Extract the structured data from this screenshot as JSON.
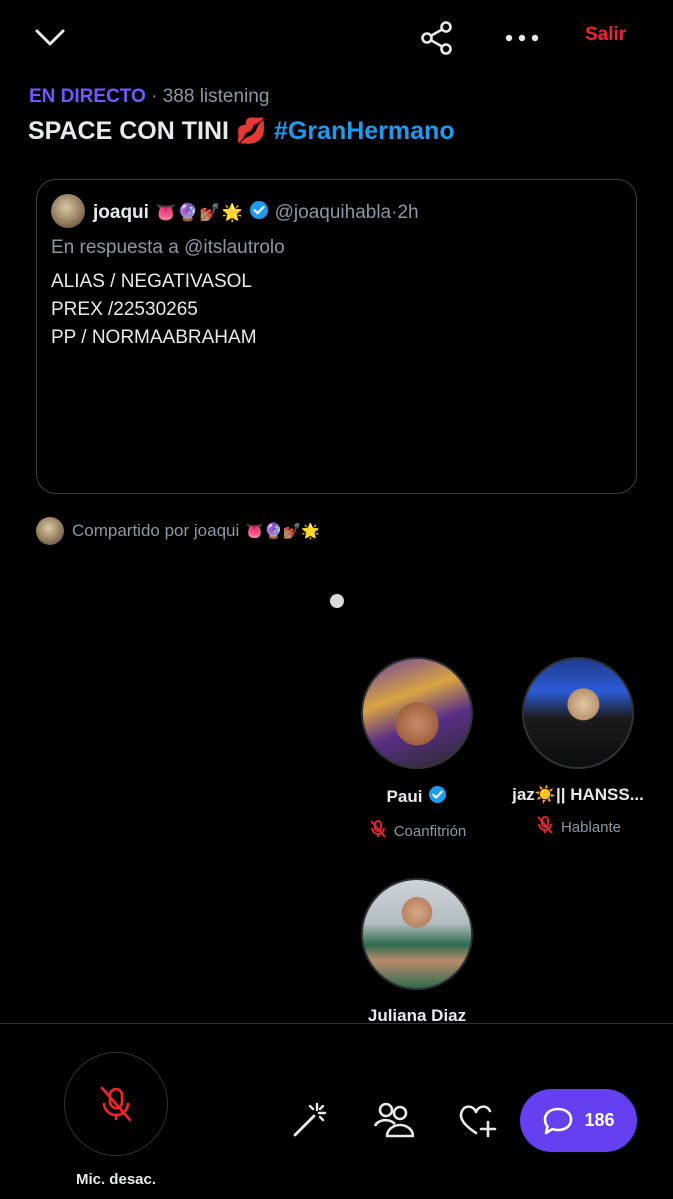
{
  "topbar": {
    "collapse_icon": "chevron-down-icon",
    "share_icon": "share-icon",
    "more_icon": "more-icon",
    "leave_label": "Salir"
  },
  "space": {
    "live_tag": "EN DIRECTO",
    "separator": "·",
    "listening": "388 listening",
    "title_text": "SPACE CON TINI 💋",
    "title_hashtag": "#GranHermano"
  },
  "pinned_tweet": {
    "name": "joaqui",
    "name_emojis": "👅🔮💅🏽🌟",
    "handle": "@joaquihabla",
    "dot": "·",
    "time": "2h",
    "reply_to": "En respuesta a @itslautrolo",
    "body_lines": [
      "ALIAS / NEGATIVASOL",
      "PREX /22530265",
      "PP / NORMAABRAHAM"
    ]
  },
  "shared_by": {
    "text": "Compartido por joaqui",
    "emojis": "👅🔮💅🏽🌟"
  },
  "speakers": [
    {
      "name": "Paui",
      "verified": true,
      "role": "Coanfitrión",
      "muted": true
    },
    {
      "name": "jaz☀️|| HANSS...",
      "verified": false,
      "role": "Hablante",
      "muted": true
    },
    {
      "name": "Juliana Diaz",
      "verified": false,
      "role": "",
      "muted": false
    }
  ],
  "bottom": {
    "mic_label": "Mic. desac.",
    "comment_count": "186"
  },
  "colors": {
    "accent": "#7856ff",
    "leave": "#f4212e",
    "hashtag": "#1d9bf0",
    "comment_button": "#6440f0"
  }
}
